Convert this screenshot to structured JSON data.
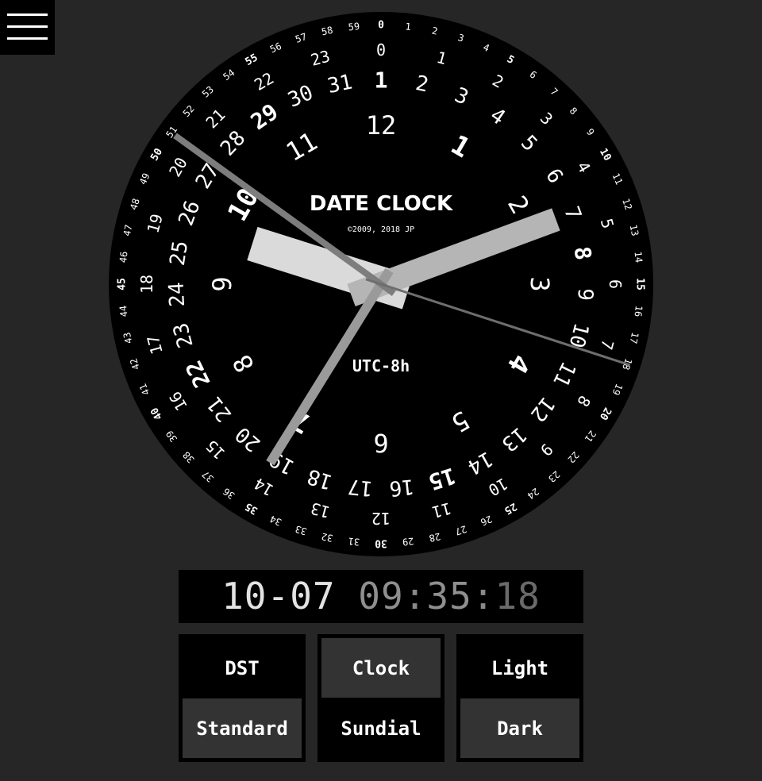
{
  "app": {
    "title": "DATE CLOCK",
    "copyright": "©2009, 2018 JP",
    "timezone": "UTC-8h"
  },
  "time": {
    "month": 10,
    "day": 7,
    "hour": 9,
    "minute": 35,
    "second": 18
  },
  "digital": {
    "date": "10-07",
    "hours": "09",
    "sep1": ":",
    "minutes": "35",
    "sep2": ":",
    "seconds": "18"
  },
  "dial": {
    "bold_minute_labels": [
      0,
      5,
      10,
      15,
      20,
      25,
      30,
      35,
      40,
      45,
      50,
      55
    ],
    "hour24_scale": [
      0,
      1,
      2,
      3,
      4,
      5,
      6,
      7,
      8,
      9,
      10,
      11,
      12,
      13,
      14,
      15,
      16,
      17,
      18,
      19,
      20,
      21,
      22,
      23
    ],
    "month_scale": [
      1,
      2,
      3,
      4,
      5,
      6,
      7,
      8,
      9,
      10,
      11,
      12
    ],
    "bold_month_labels": [
      1,
      4,
      7,
      10
    ],
    "day_scale_days": 31,
    "bold_day_labels": [
      1,
      8,
      15,
      22,
      29
    ]
  },
  "toggles": [
    {
      "options": [
        {
          "label": "DST",
          "selected": false
        },
        {
          "label": "Standard",
          "selected": true
        }
      ]
    },
    {
      "options": [
        {
          "label": "Clock",
          "selected": true
        },
        {
          "label": "Sundial",
          "selected": false
        }
      ]
    },
    {
      "options": [
        {
          "label": "Light",
          "selected": false
        },
        {
          "label": "Dark",
          "selected": true
        }
      ]
    }
  ],
  "colors": {
    "page_bg": "#262626",
    "dial_bg": "#000000",
    "hour_hand": "#dadada",
    "day_hand": "#b5b5b5",
    "minute_hand": "#9a9a9a",
    "month_hand": "#7d7d7d",
    "second_hand": "#6e6e6e",
    "selected_option": "#333333"
  }
}
